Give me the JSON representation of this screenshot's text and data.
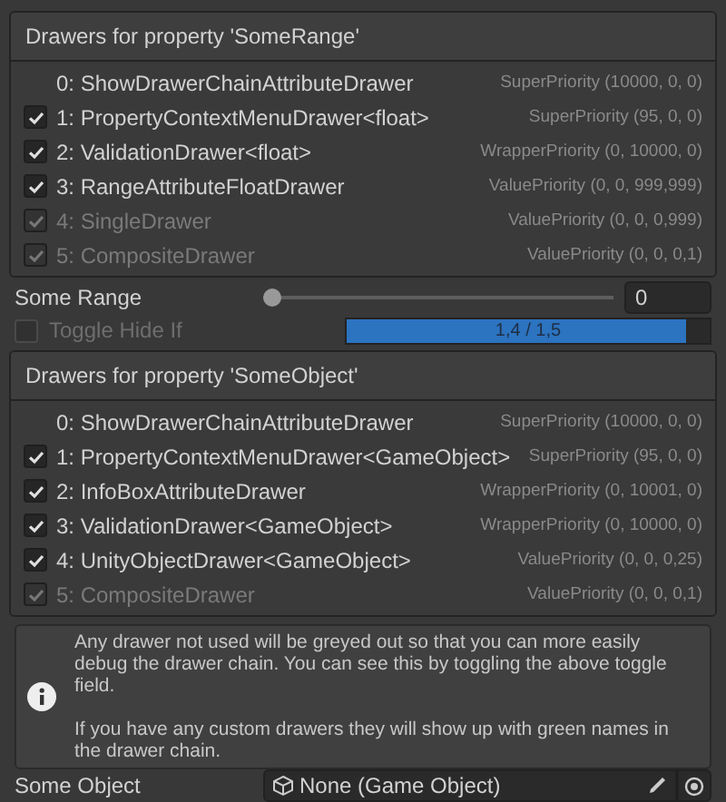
{
  "sections": [
    {
      "title": "Drawers for property 'SomeRange'",
      "drawers": [
        {
          "kind": "plain",
          "label": "0: ShowDrawerChainAttributeDrawer",
          "priority": "SuperPriority (10000, 0, 0)",
          "used": true
        },
        {
          "kind": "toggle",
          "label": "1: PropertyContextMenuDrawer<float>",
          "priority": "SuperPriority (95, 0, 0)",
          "checked": true,
          "used": true
        },
        {
          "kind": "toggle",
          "label": "2: ValidationDrawer<float>",
          "priority": "WrapperPriority (0, 10000, 0)",
          "checked": true,
          "used": true
        },
        {
          "kind": "toggle",
          "label": "3: RangeAttributeFloatDrawer",
          "priority": "ValuePriority (0, 0, 999,999)",
          "checked": true,
          "used": true
        },
        {
          "kind": "toggle",
          "label": "4: SingleDrawer",
          "priority": "ValuePriority (0, 0, 0,999)",
          "checked": true,
          "used": false
        },
        {
          "kind": "toggle",
          "label": "5: CompositeDrawer",
          "priority": "ValuePriority (0, 0, 0,1)",
          "checked": true,
          "used": false
        }
      ]
    },
    {
      "title": "Drawers for property 'SomeObject'",
      "drawers": [
        {
          "kind": "plain",
          "label": "0: ShowDrawerChainAttributeDrawer",
          "priority": "SuperPriority (10000, 0, 0)",
          "used": true
        },
        {
          "kind": "toggle",
          "label": "1: PropertyContextMenuDrawer<GameObject>",
          "priority": "SuperPriority (95, 0, 0)",
          "checked": true,
          "used": true
        },
        {
          "kind": "toggle",
          "label": "2: InfoBoxAttributeDrawer",
          "priority": "WrapperPriority (0, 10001, 0)",
          "checked": true,
          "used": true
        },
        {
          "kind": "toggle",
          "label": "3: ValidationDrawer<GameObject>",
          "priority": "WrapperPriority (0, 10000, 0)",
          "checked": true,
          "used": true
        },
        {
          "kind": "toggle",
          "label": "4: UnityObjectDrawer<GameObject>",
          "priority": "ValuePriority (0, 0, 0,25)",
          "checked": true,
          "used": true
        },
        {
          "kind": "toggle",
          "label": "5: CompositeDrawer",
          "priority": "ValuePriority (0, 0, 0,1)",
          "checked": true,
          "used": false
        }
      ]
    }
  ],
  "some_range": {
    "label": "Some Range",
    "level": 0,
    "value": "0"
  },
  "toggle_hide_if": {
    "label": "Toggle Hide If",
    "checked": false,
    "disabled": true,
    "level": 0.933,
    "reading": "1,4 / 1,5"
  },
  "info_box": {
    "paragraphs": [
      "Any drawer not used will be greyed out so that you can more easily debug the drawer chain. You can see this by toggling the above toggle field.",
      "If you have any custom drawers they will show up with green names in the drawer chain."
    ]
  },
  "some_object": {
    "label": "Some Object",
    "value": "None (Game Object)"
  }
}
